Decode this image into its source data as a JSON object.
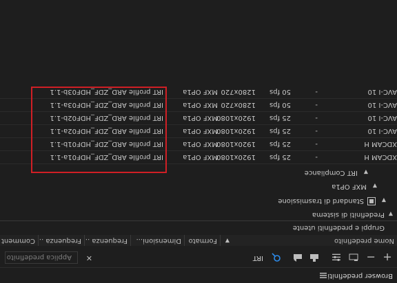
{
  "panel": {
    "title": "Browser predefiniti",
    "menu_icon": "hamburger-icon"
  },
  "toolbar": {
    "search_value": "IRT",
    "apply_label": "Applica predefinito",
    "clear_label": "✕",
    "icons": [
      "plus-icon",
      "minus-icon",
      "new-group-icon",
      "settings-icon",
      "import-icon",
      "export-icon",
      "search-icon"
    ]
  },
  "columns": [
    "Nome predefinito",
    "Formato",
    "Dimensioni...",
    "Frequenza ...",
    "Frequenza ...",
    "Comment"
  ],
  "tree": {
    "user_groups": "Gruppi e predefiniti utente",
    "system_presets": "Predefiniti di sistema",
    "broadcast_standards": "Standard di trasmissione",
    "mxf": "MXF OP1a",
    "irt": "IRT Compliance"
  },
  "presets": [
    {
      "name": "IRT profile ARD_ZDF_HDF01a-1.1",
      "format": "MXF OP1a",
      "size": "1920x1080",
      "fps": "25 fps",
      "field": "-",
      "codec": "XDCAM H"
    },
    {
      "name": "IRT profile ARD_ZDF_HDF01b-1.1",
      "format": "MXF OP1a",
      "size": "1920x1080",
      "fps": "25 fps",
      "field": "-",
      "codec": "XDCAM H"
    },
    {
      "name": "IRT profile ARD_ZDF_HDF02a-1.1",
      "format": "MXF OP1a",
      "size": "1920x1080",
      "fps": "25 fps",
      "field": "-",
      "codec": "AVC-I 10"
    },
    {
      "name": "IRT profile ARD_ZDF_HDF02b-1.1",
      "format": "MXF OP1a",
      "size": "1920x1080",
      "fps": "25 fps",
      "field": "-",
      "codec": "AVC-I 10"
    },
    {
      "name": "IRT profile ARD_ZDF_HDF03a-1.1",
      "format": "MXF OP1a",
      "size": "1280x720",
      "fps": "50 fps",
      "field": "-",
      "codec": "AVC-I 10"
    },
    {
      "name": "IRT profile ARD_ZDF_HDF03b-1.1",
      "format": "MXF OP1a",
      "size": "1280x720",
      "fps": "50 fps",
      "field": "-",
      "codec": "AVC-I 10"
    }
  ],
  "colors": {
    "highlight": "#d11f25",
    "accent": "#2d8ceb"
  }
}
